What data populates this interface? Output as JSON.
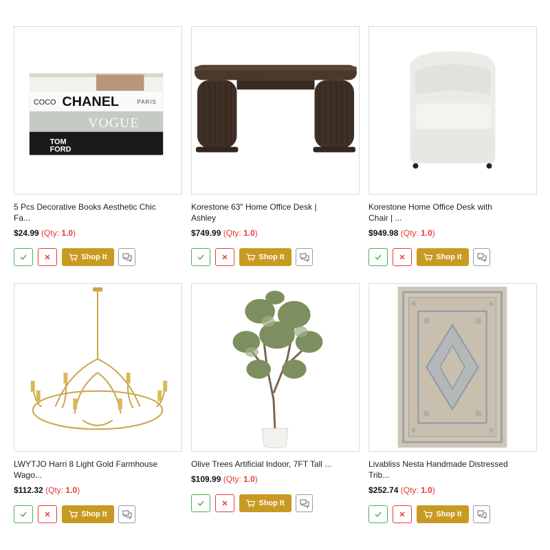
{
  "products": [
    {
      "title": "5 Pcs Decorative Books Aesthetic Chic\nFa...",
      "price": "$24.99",
      "qty_prefix": "(Qty: ",
      "qty_value": "1.0",
      "qty_suffix": ")",
      "shop_label": "Shop It",
      "image_alt": "decorative-books-image",
      "book_text": [
        "COCO",
        "CHANEL",
        "PARIS",
        "VOGUE",
        "TOM",
        "FORD"
      ]
    },
    {
      "title": "Korestone 63\" Home Office Desk |\nAshley",
      "price": "$749.99",
      "qty_prefix": "(Qty: ",
      "qty_value": "1.0",
      "qty_suffix": ")",
      "shop_label": "Shop It",
      "image_alt": "office-desk-image"
    },
    {
      "title": "Korestone Home Office Desk with\nChair | ...",
      "price": "$949.98",
      "qty_prefix": "(Qty: ",
      "qty_value": "1.0",
      "qty_suffix": ")",
      "shop_label": "Shop It",
      "image_alt": "office-chair-image"
    },
    {
      "title": "LWYTJO Harri 8 Light Gold Farmhouse\nWago...",
      "price": "$112.32",
      "qty_prefix": "(Qty: ",
      "qty_value": "1.0",
      "qty_suffix": ")",
      "shop_label": "Shop It",
      "image_alt": "chandelier-image"
    },
    {
      "title": "Olive Trees Artificial Indoor, 7FT Tall ...",
      "price": "$109.99",
      "qty_prefix": "(Qty: ",
      "qty_value": "1.0",
      "qty_suffix": ")",
      "shop_label": "Shop It",
      "image_alt": "olive-tree-image"
    },
    {
      "title": "Livabliss Nesta Handmade Distressed\nTrib...",
      "price": "$252.74",
      "qty_prefix": "(Qty: ",
      "qty_value": "1.0",
      "qty_suffix": ")",
      "shop_label": "Shop It",
      "image_alt": "rug-image"
    }
  ],
  "colors": {
    "accept": "#4caf50",
    "reject": "#e53935",
    "shop": "#c99a22",
    "chat": "#9a9a9a",
    "qty": "#e53935"
  },
  "icons": {
    "accept": "check-icon",
    "reject": "close-icon",
    "shop": "cart-icon",
    "chat": "chat-bubbles-icon"
  }
}
